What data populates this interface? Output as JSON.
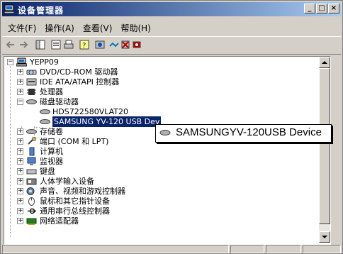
{
  "window": {
    "title": "设备管理器",
    "min_label": "_",
    "max_label": "□",
    "close_label": "×"
  },
  "menu": [
    {
      "label": "文件(F)"
    },
    {
      "label": "操作(A)"
    },
    {
      "label": "查看(V)"
    },
    {
      "label": "帮助(H)"
    }
  ],
  "tree": {
    "root": "YEPP09",
    "items": [
      {
        "label": "DVD/CD-ROM 驱动器"
      },
      {
        "label": "IDE ATA/ATAPI 控制器"
      },
      {
        "label": "处理器"
      },
      {
        "label": "磁盘驱动器"
      },
      {
        "label": "HDS722580VLAT20"
      },
      {
        "label": "SAMSUNG YV-120 USB Dev"
      },
      {
        "label": "存储卷"
      },
      {
        "label": "端口 (COM 和 LPT)"
      },
      {
        "label": "计算机"
      },
      {
        "label": "监视器"
      },
      {
        "label": "键盘"
      },
      {
        "label": "人体学输入设备"
      },
      {
        "label": "声音、视频和游戏控制器"
      },
      {
        "label": "鼠标和其它指针设备"
      },
      {
        "label": "通用串行总线控制器"
      },
      {
        "label": "网络适配器"
      }
    ]
  },
  "tooltip": {
    "text": "SAMSUNGYV-120USB Device"
  },
  "colors": {
    "titlebar_start": "#0a246a",
    "titlebar_end": "#a6caf0",
    "selection": "#0a246a",
    "face": "#d4d0c8"
  }
}
